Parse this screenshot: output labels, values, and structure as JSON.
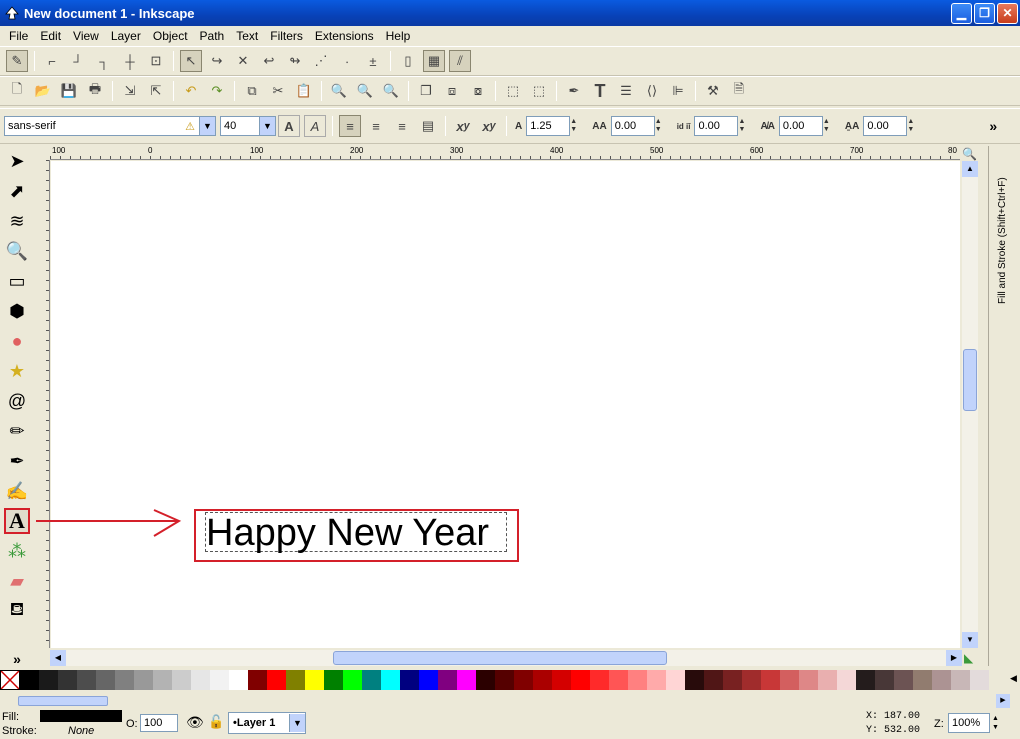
{
  "window": {
    "title": "New document 1 - Inkscape"
  },
  "menu": [
    "File",
    "Edit",
    "View",
    "Layer",
    "Object",
    "Path",
    "Text",
    "Filters",
    "Extensions",
    "Help"
  ],
  "text_toolbar": {
    "font_family": "sans-serif",
    "font_size": "40",
    "line_spacing": "1.25",
    "letter_spacing": "0.00",
    "word_spacing": "0.00",
    "kern_h": "0.00",
    "kern_v": "0.00",
    "rotation": "0.00",
    "more": "»"
  },
  "ruler": {
    "h_labels": [
      "100",
      "0",
      "100",
      "200",
      "300",
      "400",
      "500",
      "600",
      "700",
      "80"
    ]
  },
  "canvas": {
    "text_object": "Happy New Year"
  },
  "dock": {
    "label": "Fill and Stroke (Shift+Ctrl+F)"
  },
  "palette": [
    "#000000",
    "#1a1a1a",
    "#333333",
    "#4d4d4d",
    "#666666",
    "#808080",
    "#999999",
    "#b3b3b3",
    "#cccccc",
    "#e6e6e6",
    "#f2f2f2",
    "#ffffff",
    "#800000",
    "#ff0000",
    "#808000",
    "#ffff00",
    "#008000",
    "#00ff00",
    "#008080",
    "#00ffff",
    "#000080",
    "#0000ff",
    "#800080",
    "#ff00ff",
    "#2b0000",
    "#550000",
    "#800000",
    "#aa0000",
    "#d40000",
    "#ff0000",
    "#ff2a2a",
    "#ff5555",
    "#ff8080",
    "#ffaaaa",
    "#ffd5d5",
    "#280b0b",
    "#501616",
    "#782121",
    "#a02c2c",
    "#c83737",
    "#d35f5f",
    "#de8787",
    "#e9afaf",
    "#f4d7d7",
    "#241c1c",
    "#483737",
    "#6c5353",
    "#917c6f",
    "#ac9393",
    "#c8b7b7",
    "#e3dbdb"
  ],
  "status": {
    "fill_label": "Fill:",
    "stroke_label": "Stroke:",
    "stroke_value": "None",
    "opacity_label": "O:",
    "opacity_value": "100",
    "layer": "•Layer 1",
    "x_label": "X:",
    "x_value": "187.00",
    "y_label": "Y:",
    "y_value": "532.00",
    "zoom_label": "Z:",
    "zoom_value": "100%"
  },
  "colors": {
    "annotation": "#d4202a",
    "fill_swatch": "#000000"
  }
}
